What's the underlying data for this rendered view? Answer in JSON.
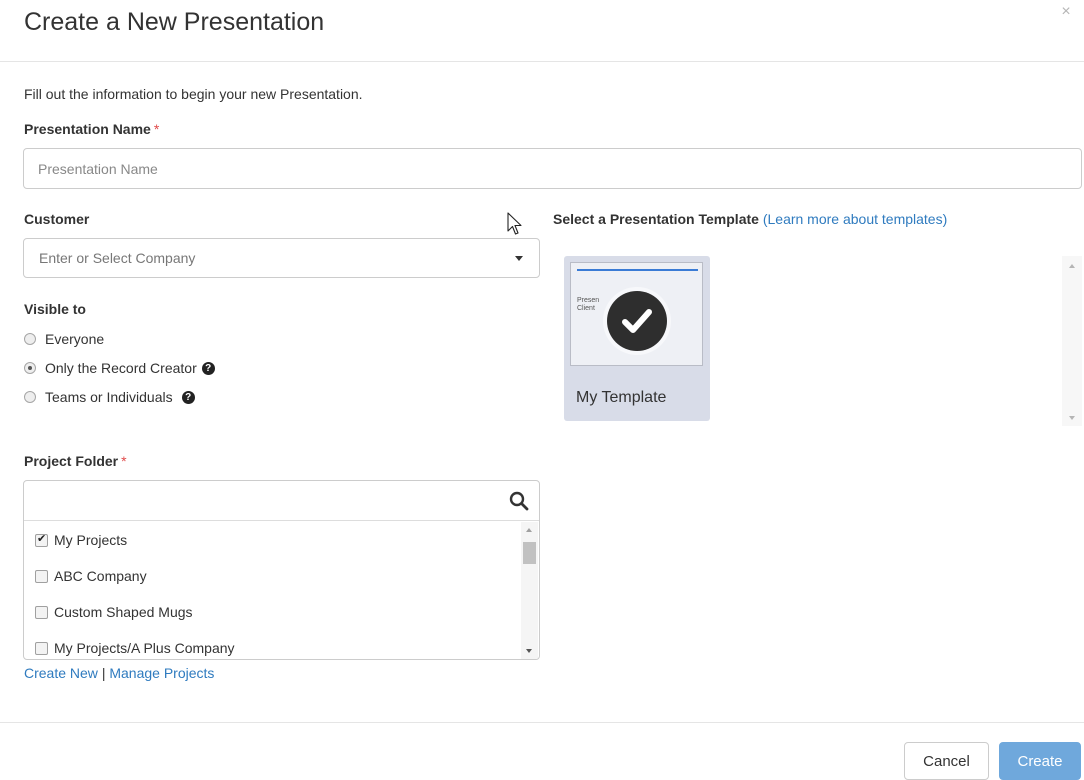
{
  "dialog": {
    "title": "Create a New Presentation",
    "close_label": "×",
    "intro": "Fill out the information to begin your new Presentation."
  },
  "presentation_name": {
    "label": "Presentation Name",
    "required_mark": "*",
    "placeholder": "Presentation Name",
    "value": ""
  },
  "customer": {
    "label": "Customer",
    "placeholder": "Enter or Select Company"
  },
  "visibility": {
    "label": "Visible to",
    "options": [
      {
        "label": "Everyone",
        "checked": false,
        "help": false
      },
      {
        "label": "Only the Record Creator",
        "checked": true,
        "help": true
      },
      {
        "label": "Teams or Individuals",
        "checked": false,
        "help": true
      }
    ],
    "help_glyph": "?"
  },
  "project_folder": {
    "label": "Project Folder",
    "required_mark": "*",
    "search_value": "",
    "items": [
      {
        "label": "My Projects",
        "checked": true
      },
      {
        "label": "ABC Company",
        "checked": false
      },
      {
        "label": "Custom Shaped Mugs",
        "checked": false
      },
      {
        "label": "My Projects/A Plus Company",
        "checked": false
      }
    ],
    "create_new_label": "Create New",
    "separator": "|",
    "manage_label": "Manage Projects"
  },
  "template": {
    "heading": "Select a Presentation Template",
    "learn_more": "(Learn more about templates)",
    "cards": [
      {
        "name": "My Template",
        "thumb_text": "Presen",
        "thumb_subtext": "Client",
        "selected": true
      }
    ]
  },
  "footer": {
    "cancel_label": "Cancel",
    "create_label": "Create"
  },
  "colors": {
    "link": "#2f7bbf",
    "primary_button": "#6fa8dc",
    "required": "#e04a4a",
    "template_card_bg": "#d8dce8"
  }
}
